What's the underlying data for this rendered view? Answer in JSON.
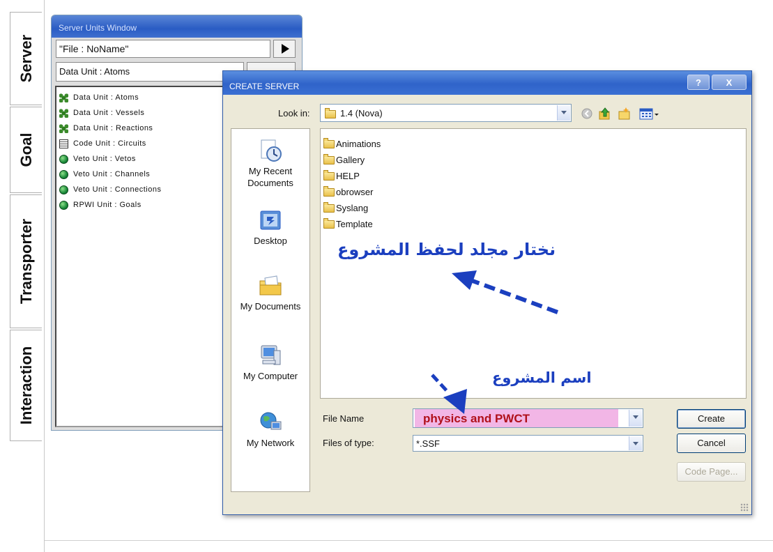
{
  "tabs": [
    {
      "label": "Server"
    },
    {
      "label": "Goal"
    },
    {
      "label": "Transporter"
    },
    {
      "label": "Interaction"
    }
  ],
  "server_units_window": {
    "title": "Server Units Window",
    "file_label": "\"File : NoName\"",
    "selected_unit": "Data Unit : Atoms",
    "units": [
      {
        "label": "Data Unit : Atoms",
        "icon": "atom-icon"
      },
      {
        "label": "Data Unit : Vessels",
        "icon": "atom-icon"
      },
      {
        "label": "Data Unit : Reactions",
        "icon": "atom-icon"
      },
      {
        "label": "Code Unit : Circuits",
        "icon": "code-icon"
      },
      {
        "label": "Veto Unit : Vetos",
        "icon": "globe-icon"
      },
      {
        "label": "Veto Unit : Channels",
        "icon": "globe-icon"
      },
      {
        "label": "Veto Unit : Connections",
        "icon": "globe-icon"
      },
      {
        "label": "RPWI Unit : Goals",
        "icon": "globe-icon"
      }
    ]
  },
  "dialog": {
    "title": "CREATE SERVER",
    "help_label": "?",
    "close_label": "X",
    "look_in_label": "Look in:",
    "look_in_value": "1.4 (Nova)",
    "places": [
      {
        "label": "My Recent Documents"
      },
      {
        "label": "Desktop"
      },
      {
        "label": "My Documents"
      },
      {
        "label": "My Computer"
      },
      {
        "label": "My Network"
      }
    ],
    "folders": [
      "Animations",
      "Gallery",
      "HELP",
      "obrowser",
      "Syslang",
      "Template"
    ],
    "file_name_label": "File Name",
    "file_name_value": "physics and PWCT",
    "file_type_label": "Files of type:",
    "file_type_value": "*.SSF",
    "create_label": "Create",
    "cancel_label": "Cancel",
    "code_page_label": "Code Page...",
    "annotation_folder": "نختار مجلد لحفظ المشروع",
    "annotation_name": "اسم المشروع",
    "colors": {
      "title_blue": "#2f63c9",
      "annotation_blue": "#1b3fbf",
      "highlight_pink": "#f2b6e6",
      "file_name_red": "#b0101a"
    }
  }
}
